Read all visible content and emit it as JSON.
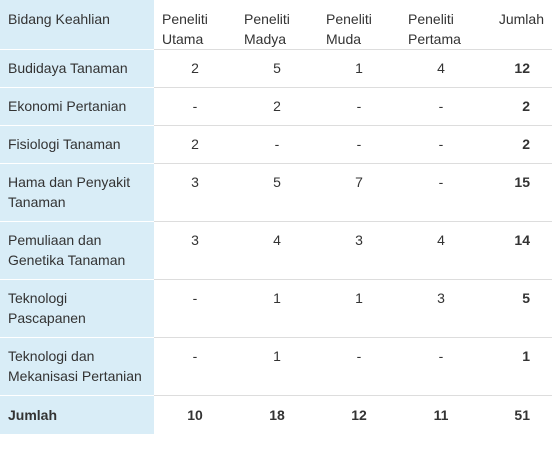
{
  "table": {
    "headers": [
      "Bidang Keahlian",
      "Peneliti Utama",
      "Peneliti Madya",
      "Peneliti Muda",
      "Peneliti Pertama",
      "Jumlah"
    ],
    "rows": [
      {
        "field": "Budidaya Tanaman",
        "utama": "2",
        "madya": "5",
        "muda": "1",
        "pertama": "4",
        "jumlah": "12"
      },
      {
        "field": "Ekonomi Pertanian",
        "utama": "-",
        "madya": "2",
        "muda": "-",
        "pertama": "-",
        "jumlah": "2"
      },
      {
        "field": "Fisiologi Tanaman",
        "utama": "2",
        "madya": "-",
        "muda": "-",
        "pertama": "-",
        "jumlah": "2"
      },
      {
        "field": "Hama dan Penyakit Tanaman",
        "utama": "3",
        "madya": "5",
        "muda": "7",
        "pertama": "-",
        "jumlah": "15"
      },
      {
        "field": "Pemuliaan dan Genetika Tanaman",
        "utama": "3",
        "madya": "4",
        "muda": "3",
        "pertama": "4",
        "jumlah": "14"
      },
      {
        "field": "Teknologi Pascapanen",
        "utama": "-",
        "madya": "1",
        "muda": "1",
        "pertama": "3",
        "jumlah": "5"
      },
      {
        "field": "Teknologi dan Mekanisasi Pertanian",
        "utama": "-",
        "madya": "1",
        "muda": "-",
        "pertama": "-",
        "jumlah": "1"
      }
    ],
    "footer": {
      "field": "Jumlah",
      "utama": "10",
      "madya": "18",
      "muda": "12",
      "pertama": "11",
      "jumlah": "51"
    }
  },
  "colors": {
    "header_bg": "#d9edf7",
    "text": "#333333",
    "border": "#dddddd"
  }
}
